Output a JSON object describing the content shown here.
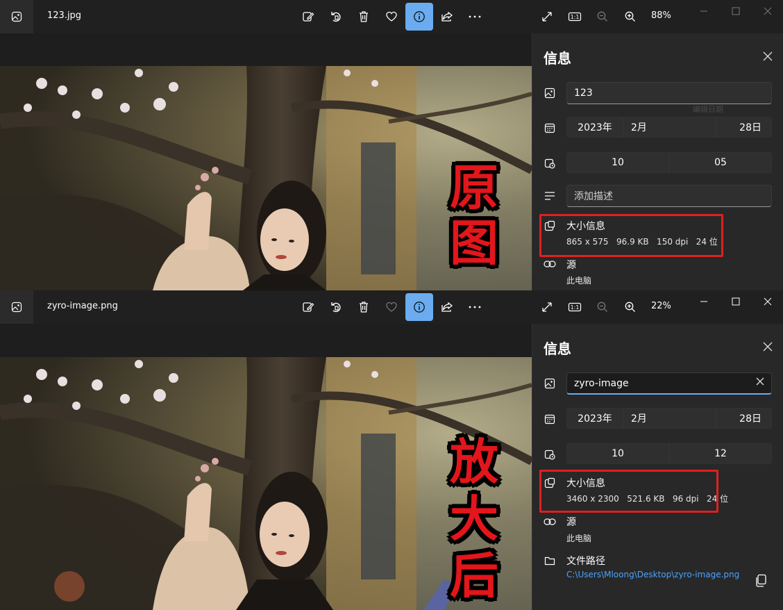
{
  "windows": [
    {
      "filename": "123.jpg",
      "zoom": "88%",
      "overlay_label": [
        "原",
        "图"
      ],
      "info": {
        "title": "信息",
        "name_value": "123",
        "ghost_hint": "编辑日期",
        "date": {
          "year": "2023年",
          "month": "2月",
          "day": "28日"
        },
        "time": {
          "hour": "10",
          "minute": "05"
        },
        "description_placeholder": "添加描述",
        "size_label": "大小信息",
        "size_details": "865 x 575   96.9 KB   150 dpi   24 位",
        "source_label": "源",
        "source_value": "此电脑"
      }
    },
    {
      "filename": "zyro-image.png",
      "zoom": "22%",
      "overlay_label": [
        "放",
        "大",
        "后"
      ],
      "info": {
        "title": "信息",
        "name_value": "zyro-image",
        "date": {
          "year": "2023年",
          "month": "2月",
          "day": "28日"
        },
        "time": {
          "hour": "10",
          "minute": "12"
        },
        "size_label": "大小信息",
        "size_details": "3460 x 2300   521.6 KB   96 dpi   24 位",
        "source_label": "源",
        "source_value": "此电脑",
        "path_label": "文件路径",
        "path_value": "C:\\Users\\Mloong\\Desktop\\zyro-image.png"
      }
    }
  ],
  "colors": {
    "accent": "#6aacef",
    "highlight": "#e02020",
    "overlay_text": "#e3161b",
    "link": "#4aa3ff"
  },
  "icons": [
    "image-icon",
    "edit-icon",
    "rotate-icon",
    "delete-icon",
    "heart-icon",
    "info-icon",
    "share-icon",
    "more-icon",
    "fullscreen-icon",
    "actual-size-icon",
    "zoom-out-icon",
    "zoom-in-icon",
    "minimize-icon",
    "maximize-icon",
    "close-icon",
    "calendar-icon",
    "clock-icon",
    "description-icon",
    "size-icon",
    "link-icon",
    "folder-icon",
    "copy-icon"
  ]
}
